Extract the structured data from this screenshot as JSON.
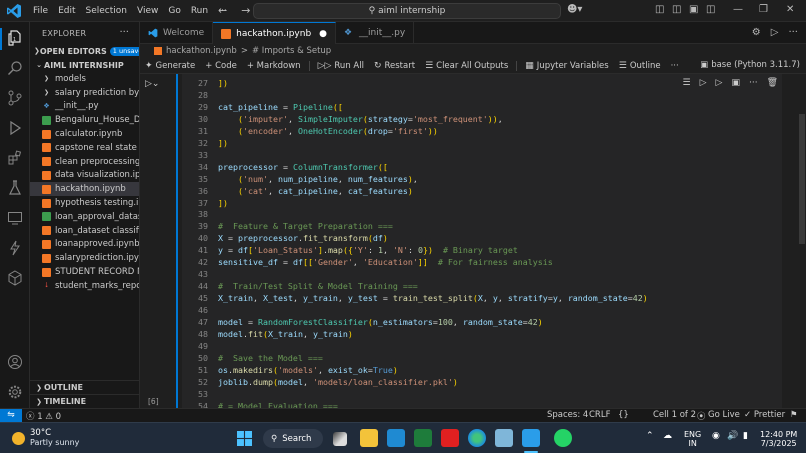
{
  "window": {
    "menu": [
      "File",
      "Edit",
      "Selection",
      "View",
      "Go",
      "Run"
    ],
    "menu_more": "···",
    "search": "aiml internship"
  },
  "explorer": {
    "title": "EXPLORER",
    "open_editors": "OPEN EDITORS",
    "unsaved": "1 unsaved",
    "project": "AIML INTERNSHIP",
    "items": [
      {
        "label": "models",
        "icon": "folder-chevron-icon"
      },
      {
        "label": "salary prediction by li...",
        "icon": "folder-chevron-icon"
      },
      {
        "label": "__init__.py",
        "icon": "python-file-icon"
      },
      {
        "label": "Bengaluru_House_Dat...",
        "icon": "csv-file-icon"
      },
      {
        "label": "calculator.ipynb",
        "icon": "notebook-file-icon"
      },
      {
        "label": "capstone real state pr...",
        "icon": "notebook-file-icon"
      },
      {
        "label": "clean preprocessing d...",
        "icon": "notebook-file-icon"
      },
      {
        "label": "data visualization.ipynb",
        "icon": "notebook-file-icon"
      },
      {
        "label": "hackathon.ipynb",
        "icon": "notebook-file-icon"
      },
      {
        "label": "hypothesis testing.ipy...",
        "icon": "notebook-file-icon"
      },
      {
        "label": "loan_approval_datase...",
        "icon": "csv-file-icon"
      },
      {
        "label": "loan_dataset classifica...",
        "icon": "notebook-file-icon"
      },
      {
        "label": "loanapproved.ipynb",
        "icon": "notebook-file-icon"
      },
      {
        "label": "salaryprediction.ipynb",
        "icon": "notebook-file-icon"
      },
      {
        "label": "STUDENT RECORD M...",
        "icon": "notebook-file-icon"
      },
      {
        "label": "student_marks_report....",
        "icon": "pdf-file-icon"
      }
    ],
    "selected_index": 8,
    "outline": "OUTLINE",
    "timeline": "TIMELINE"
  },
  "tabs": [
    {
      "label": "Welcome",
      "active": false
    },
    {
      "label": "hackathon.ipynb",
      "active": true
    },
    {
      "label": "__init__.py",
      "active": false
    }
  ],
  "breadcrumb": {
    "file": "hackathon.ipynb",
    "sep": ">",
    "section": "# Imports & Setup"
  },
  "toolbar": {
    "generate": "Generate",
    "code": "+ Code",
    "markdown": "+ Markdown",
    "run_all": "Run All",
    "restart": "Restart",
    "clear": "Clear All Outputs",
    "variables": "Jupyter Variables",
    "outline": "Outline",
    "more": "···",
    "kernel": "base (Python 3.11.7)"
  },
  "cell": {
    "exec_count": "[6]"
  },
  "code_lines": [
    {
      "n": "27",
      "t": "])"
    },
    {
      "n": "28",
      "t": ""
    },
    {
      "n": "29",
      "t": "cat_pipeline = Pipeline(["
    },
    {
      "n": "30",
      "t": "    ('imputer', SimpleImputer(strategy='most_frequent')),"
    },
    {
      "n": "31",
      "t": "    ('encoder', OneHotEncoder(drop='first'))"
    },
    {
      "n": "32",
      "t": "])"
    },
    {
      "n": "33",
      "t": ""
    },
    {
      "n": "34",
      "t": "preprocessor = ColumnTransformer(["
    },
    {
      "n": "35",
      "t": "    ('num', num_pipeline, num_features),"
    },
    {
      "n": "36",
      "t": "    ('cat', cat_pipeline, cat_features)"
    },
    {
      "n": "37",
      "t": "])"
    },
    {
      "n": "38",
      "t": ""
    },
    {
      "n": "39",
      "t": "#  Feature & Target Preparation ==="
    },
    {
      "n": "40",
      "t": "X = preprocessor.fit_transform(df)"
    },
    {
      "n": "41",
      "t": "y = df['Loan_Status'].map({'Y': 1, 'N': 0})  # Binary target"
    },
    {
      "n": "42",
      "t": "sensitive_df = df[['Gender', 'Education']]  # For fairness analysis"
    },
    {
      "n": "43",
      "t": ""
    },
    {
      "n": "44",
      "t": "#  Train/Test Split & Model Training ==="
    },
    {
      "n": "45",
      "t": "X_train, X_test, y_train, y_test = train_test_split(X, y, stratify=y, random_state=42)"
    },
    {
      "n": "46",
      "t": ""
    },
    {
      "n": "47",
      "t": "model = RandomForestClassifier(n_estimators=100, random_state=42)"
    },
    {
      "n": "48",
      "t": "model.fit(X_train, y_train)"
    },
    {
      "n": "49",
      "t": ""
    },
    {
      "n": "50",
      "t": "#  Save the Model ==="
    },
    {
      "n": "51",
      "t": "os.makedirs('models', exist_ok=True)"
    },
    {
      "n": "52",
      "t": "joblib.dump(model, 'models/loan_classifier.pkl')"
    },
    {
      "n": "53",
      "t": ""
    },
    {
      "n": "54",
      "t": "# = Model Evaluation ==="
    }
  ],
  "status": {
    "problems": "ⓧ 1 ⚠ 0",
    "spaces": "Spaces: 4",
    "eol": "CRLF",
    "braces": "{}",
    "cell": "Cell 1 of 2",
    "golive": "Go Live",
    "prettier": "✓ Prettier"
  },
  "taskbar": {
    "temp": "30°C",
    "weather": "Partly sunny",
    "search": "Search",
    "lang1": "ENG",
    "lang2": "IN",
    "time": "12:40 PM",
    "date": "7/3/2025"
  },
  "colors": {
    "accent": "#0078d4",
    "keyword": "#c586c0",
    "string": "#ce9178",
    "function": "#dcdcaa",
    "class": "#4ec9b0",
    "comment": "#6a9955",
    "number": "#b5cea8",
    "param": "#9cdcfe"
  }
}
